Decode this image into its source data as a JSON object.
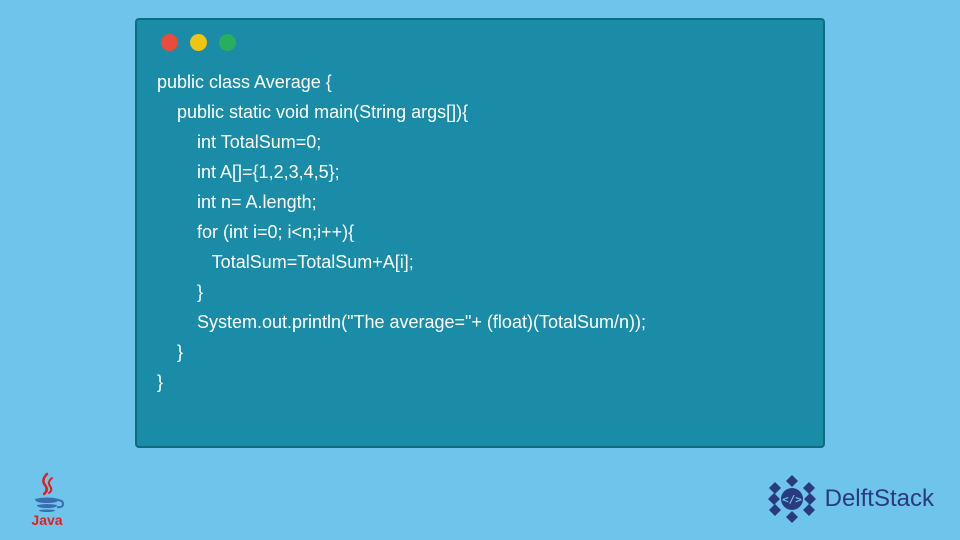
{
  "code": {
    "line1": "public class Average {",
    "line2": "    public static void main(String args[]){",
    "line3": "        int TotalSum=0;",
    "line4": "        int A[]={1,2,3,4,5};",
    "line5": "        int n= A.length;",
    "line6": "        for (int i=0; i<n;i++){",
    "line7": "           TotalSum=TotalSum+A[i];",
    "line8": "        }",
    "line9": "        System.out.println(\"The average=\"+ (float)(TotalSum/n));",
    "line10": "    }",
    "line11": "}"
  },
  "logos": {
    "java_label": "Java",
    "delft_label": "DelftStack"
  },
  "colors": {
    "background": "#6fc4eb",
    "window": "#1a8ca8",
    "red_dot": "#e74c3c",
    "yellow_dot": "#f1c40f",
    "green_dot": "#27ae60"
  }
}
